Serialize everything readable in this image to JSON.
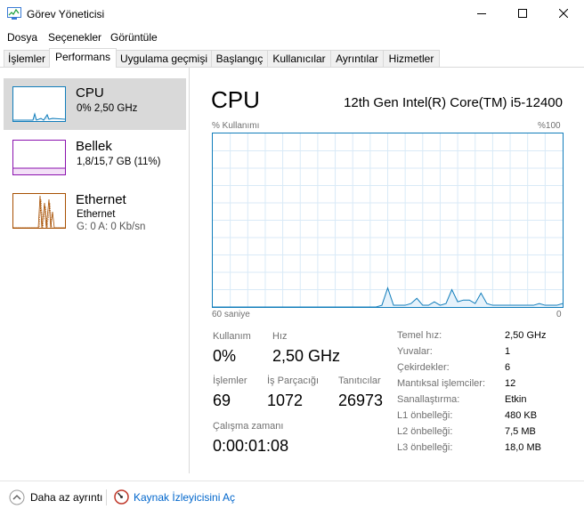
{
  "window": {
    "title": "Görev Yöneticisi"
  },
  "menu": [
    "Dosya",
    "Seçenekler",
    "Görüntüle"
  ],
  "tabs": [
    "İşlemler",
    "Performans",
    "Uygulama geçmişi",
    "Başlangıç",
    "Kullanıcılar",
    "Ayrıntılar",
    "Hizmetler"
  ],
  "active_tab": "Performans",
  "resources": [
    {
      "name": "CPU",
      "line1": "0% 2,50 GHz",
      "color": "#117dbb"
    },
    {
      "name": "Bellek",
      "line1": "1,8/15,7 GB (11%)",
      "color": "#8b12ae"
    },
    {
      "name": "Ethernet",
      "line1": "Ethernet",
      "line2": "G: 0 A: 0 Kb/sn",
      "color": "#a74f01"
    }
  ],
  "main": {
    "title": "CPU",
    "model": "12th Gen Intel(R) Core(TM) i5-12400",
    "graph_label_left": "% Kullanımı",
    "graph_label_right": "%100",
    "graph_time_left": "60 saniye",
    "graph_time_right": "0"
  },
  "graph": {
    "y_range": [
      0,
      100
    ],
    "utilization_percent": [
      0,
      0,
      0,
      0,
      0,
      0,
      0,
      0,
      0,
      0,
      0,
      0,
      0,
      0,
      0,
      0,
      0,
      0,
      0,
      0,
      0,
      0,
      0,
      0,
      0,
      0,
      0,
      0,
      0,
      1,
      11,
      1,
      1,
      1,
      2,
      5,
      1,
      1,
      3,
      1,
      2,
      10,
      3,
      4,
      4,
      2,
      8,
      2,
      1,
      1,
      1,
      1,
      1,
      1,
      1,
      1,
      2,
      1,
      1,
      1,
      2
    ]
  },
  "stats": {
    "usage_label": "Kullanım",
    "usage_value": "0%",
    "speed_label": "Hız",
    "speed_value": "2,50 GHz",
    "processes_label": "İşlemler",
    "processes_value": "69",
    "threads_label": "İş Parçacığı",
    "threads_value": "1072",
    "handles_label": "Tanıtıcılar",
    "handles_value": "26973",
    "uptime_label": "Çalışma zamanı",
    "uptime_value": "0:00:01:08"
  },
  "details": [
    {
      "key": "Temel hız:",
      "value": "2,50 GHz"
    },
    {
      "key": "Yuvalar:",
      "value": "1"
    },
    {
      "key": "Çekirdekler:",
      "value": "6"
    },
    {
      "key": "Mantıksal işlemciler:",
      "value": "12"
    },
    {
      "key": "Sanallaştırma:",
      "value": "Etkin"
    },
    {
      "key": "L1 önbelleği:",
      "value": "480 KB"
    },
    {
      "key": "L2 önbelleği:",
      "value": "7,5 MB"
    },
    {
      "key": "L3 önbelleği:",
      "value": "18,0 MB"
    }
  ],
  "footer": {
    "fewer_details": "Daha az ayrıntı",
    "resource_monitor": "Kaynak İzleyicisini Aç"
  },
  "icons": [
    "task-manager-icon",
    "minimize-icon",
    "maximize-icon",
    "close-icon",
    "chevron-up-icon",
    "resource-monitor-icon"
  ]
}
